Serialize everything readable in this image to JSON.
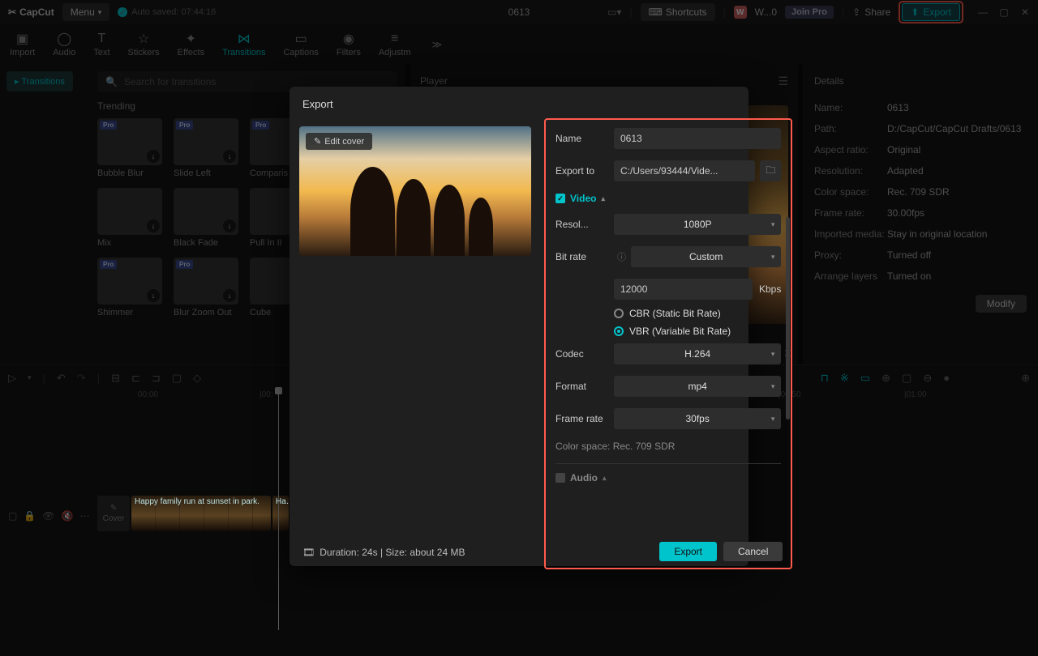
{
  "app": {
    "name": "CapCut",
    "menu": "Menu",
    "autosave": "Auto saved: 07:44:16",
    "projectTitle": "0613"
  },
  "topbar": {
    "shortcuts": "Shortcuts",
    "w": "W",
    "wlabel": "W...0",
    "joinpro": "Join Pro",
    "share": "Share",
    "export": "Export"
  },
  "ribbon": {
    "items": [
      "Import",
      "Audio",
      "Text",
      "Stickers",
      "Effects",
      "Transitions",
      "Captions",
      "Filters",
      "Adjustm"
    ]
  },
  "sidetab": {
    "label": "Transitions"
  },
  "search": {
    "placeholder": "Search for transitions"
  },
  "trending": "Trending",
  "thumbs": [
    {
      "label": "Bubble Blur",
      "pro": true
    },
    {
      "label": "Slide Left",
      "pro": true
    },
    {
      "label": "Comparis",
      "pro": true
    },
    {
      "label": "Mix",
      "pro": false
    },
    {
      "label": "Black Fade",
      "pro": false
    },
    {
      "label": "Pull In II",
      "pro": false
    },
    {
      "label": "Shimmer",
      "pro": true
    },
    {
      "label": "Blur Zoom Out",
      "pro": true
    },
    {
      "label": "Cube",
      "pro": false
    }
  ],
  "player": {
    "title": "Player",
    "ratio": "[Ratio]"
  },
  "details": {
    "title": "Details",
    "rows": [
      {
        "k": "Name:",
        "v": "0613"
      },
      {
        "k": "Path:",
        "v": "D:/CapCut/CapCut Drafts/0613"
      },
      {
        "k": "Aspect ratio:",
        "v": "Original"
      },
      {
        "k": "Resolution:",
        "v": "Adapted"
      },
      {
        "k": "Color space:",
        "v": "Rec. 709 SDR"
      },
      {
        "k": "Frame rate:",
        "v": "30.00fps"
      },
      {
        "k": "Imported media:",
        "v": "Stay in original location"
      },
      {
        "k": "Proxy:",
        "v": "Turned off"
      },
      {
        "k": "Arrange layers",
        "v": "Turned on"
      }
    ],
    "modify": "Modify"
  },
  "timeline": {
    "ticks": [
      "00:00",
      "|00:",
      "|00:50",
      "|01:00"
    ],
    "cover": "Cover",
    "clip": "Happy family run at sunset in park.",
    "clip2": "Ha…"
  },
  "modal": {
    "title": "Export",
    "editCover": "Edit cover",
    "name_l": "Name",
    "name_v": "0613",
    "exportto_l": "Export to",
    "exportto_v": "C:/Users/93444/Vide...",
    "video": "Video",
    "res_l": "Resol...",
    "res_v": "1080P",
    "bitrate_l": "Bit rate",
    "bitrate_v": "Custom",
    "kbps_v": "12000",
    "kbps_u": "Kbps",
    "cbr": "CBR (Static Bit Rate)",
    "vbr": "VBR (Variable Bit Rate)",
    "codec_l": "Codec",
    "codec_v": "H.264",
    "format_l": "Format",
    "format_v": "mp4",
    "fps_l": "Frame rate",
    "fps_v": "30fps",
    "colorspace": "Color space: Rec. 709 SDR",
    "audio": "Audio",
    "footinfo": "Duration: 24s | Size: about 24 MB",
    "export_btn": "Export",
    "cancel_btn": "Cancel"
  }
}
